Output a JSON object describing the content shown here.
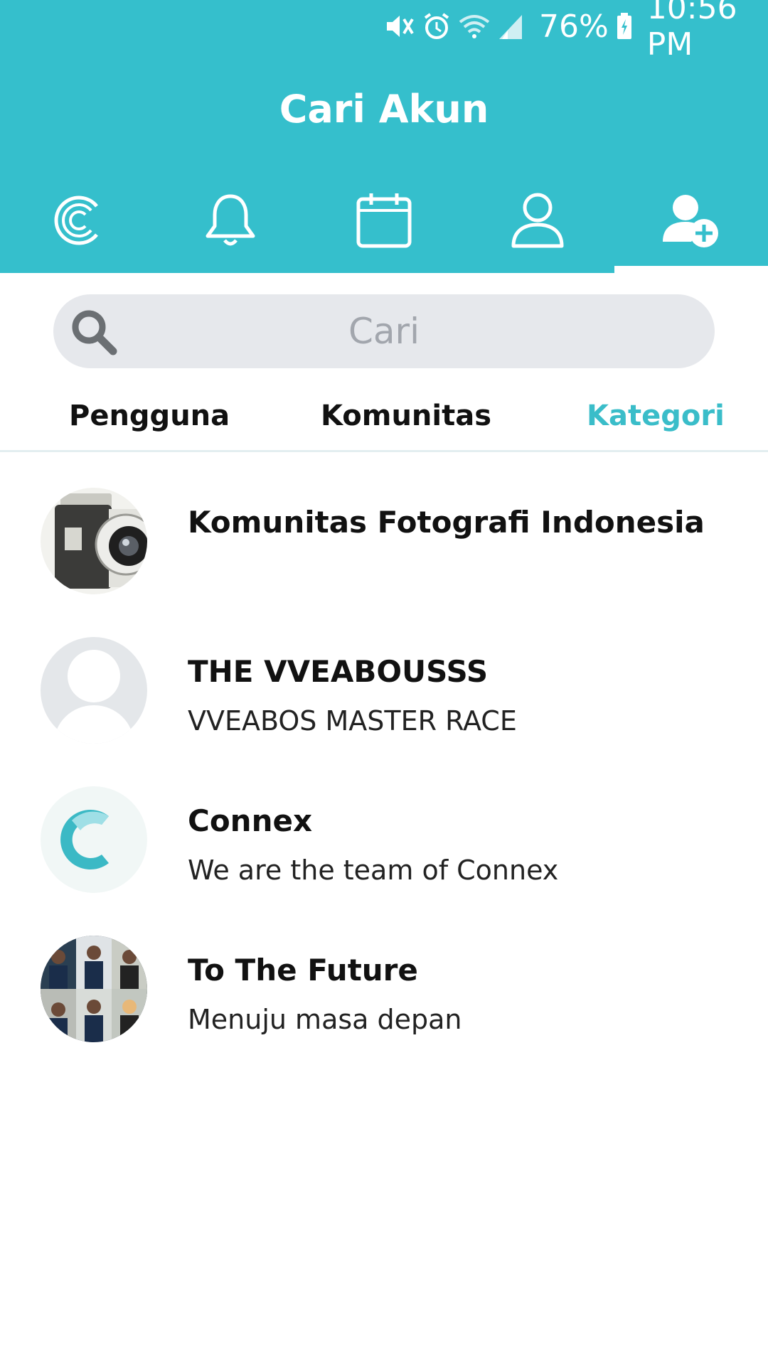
{
  "status_bar": {
    "battery": "76%",
    "time": "10:56 PM",
    "icons": [
      "mute-icon",
      "alarm-icon",
      "wifi-icon",
      "signal-icon",
      "battery-icon"
    ]
  },
  "header": {
    "title": "Cari Akun",
    "accent_color": "#35BFCC"
  },
  "nav": {
    "tabs": [
      {
        "icon": "connex-logo-icon"
      },
      {
        "icon": "bell-icon"
      },
      {
        "icon": "calendar-icon"
      },
      {
        "icon": "profile-icon"
      },
      {
        "icon": "add-user-icon",
        "active": true
      }
    ]
  },
  "search": {
    "placeholder": "Cari"
  },
  "category_tabs": {
    "items": [
      {
        "label": "Pengguna"
      },
      {
        "label": "Komunitas"
      },
      {
        "label": "Kategori",
        "active": true
      }
    ],
    "active_color": "#3ABDC9"
  },
  "communities": [
    {
      "name": "Komunitas Fotografi Indonesia",
      "description": "",
      "avatar": "camera-photo"
    },
    {
      "name": "THE VVEABOUSSS",
      "description": "VVEABOS MASTER RACE",
      "avatar": "default-avatar"
    },
    {
      "name": "Connex",
      "description": "We are the team of Connex",
      "avatar": "connex-logo"
    },
    {
      "name": "To The Future",
      "description": "Menuju masa depan",
      "avatar": "group-photo-collage"
    }
  ]
}
